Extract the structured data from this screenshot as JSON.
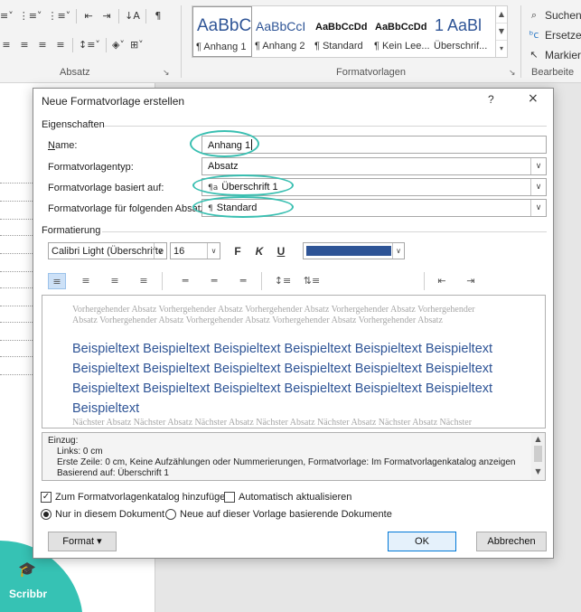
{
  "ribbon": {
    "absatz_label": "Absatz",
    "formatvorlagen_label": "Formatvorlagen",
    "bearbeiten_label": "Bearbeite",
    "launcher_glyph": "↘",
    "styles": [
      {
        "sample": "AaBbC(",
        "name": "¶ Anhang 1"
      },
      {
        "sample": "AaBbCcI",
        "name": "¶ Anhang 2"
      },
      {
        "sample": "AaBbCcDd",
        "name": "¶ Standard"
      },
      {
        "sample": "AaBbCcDd",
        "name": "¶ Kein Lee..."
      },
      {
        "sample": "1 AaBl",
        "name": "Überschrif..."
      }
    ],
    "edit": {
      "search": "Suchen",
      "replace": "Ersetzen",
      "select": "Markiere"
    }
  },
  "dialog": {
    "title": "Neue Formatvorlage erstellen",
    "help": "?",
    "close": "×",
    "section_properties": "Eigenschaften",
    "name_label": "Name:",
    "name_value": "Anhang 1",
    "type_label": "Formatvorlagentyp:",
    "type_value": "Absatz",
    "based_label": "Formatvorlage basiert auf:",
    "based_value": "Überschrift 1",
    "next_label": "Formatvorlage für folgenden Absatz:",
    "next_value": "Standard",
    "section_formatting": "Formatierung",
    "font_value": "Calibri Light (Überschrifte",
    "size_value": "16",
    "bold": "F",
    "italic": "K",
    "underline": "U",
    "font_color": "#2e5496",
    "preview": {
      "prev_line1": "Vorhergehender Absatz Vorhergehender Absatz Vorhergehender Absatz Vorhergehender Absatz Vorhergehender",
      "prev_line2": "Absatz Vorhergehender Absatz Vorhergehender Absatz Vorhergehender Absatz Vorhergehender Absatz",
      "sample_line1": "Beispieltext Beispieltext Beispieltext Beispieltext Beispieltext Beispieltext",
      "sample_line2": "Beispieltext Beispieltext Beispieltext Beispieltext Beispieltext Beispieltext",
      "sample_line3": "Beispieltext Beispieltext Beispieltext Beispieltext Beispieltext Beispieltext",
      "sample_line4": "Beispieltext",
      "next_line": "Nächster Absatz Nächster Absatz Nächster Absatz Nächster Absatz Nächster Absatz Nächster Absatz Nächster"
    },
    "description": {
      "line1": "Einzug:",
      "line2": "Links:  0 cm",
      "line3": "Erste Zeile:  0 cm,  Keine Aufzählungen oder Nummerierungen, Formatvorlage: Im Formatvorlagenkatalog anzeigen",
      "line4": "Basierend auf: Überschrift 1"
    },
    "add_to_gallery": "Zum Formatvorlagenkatalog hinzufügen",
    "auto_update": "Automatisch aktualisieren",
    "only_this_doc": "Nur in diesem Dokument",
    "new_docs": "Neue auf dieser Vorlage basierende Dokumente",
    "format_button": "Format ▾",
    "ok_button": "OK",
    "cancel_button": "Abbrechen"
  },
  "brand": {
    "name": "Scribbr",
    "color": "#36c2b4"
  },
  "colors": {
    "highlight": "#39bfb1",
    "accent": "#0078d7"
  }
}
